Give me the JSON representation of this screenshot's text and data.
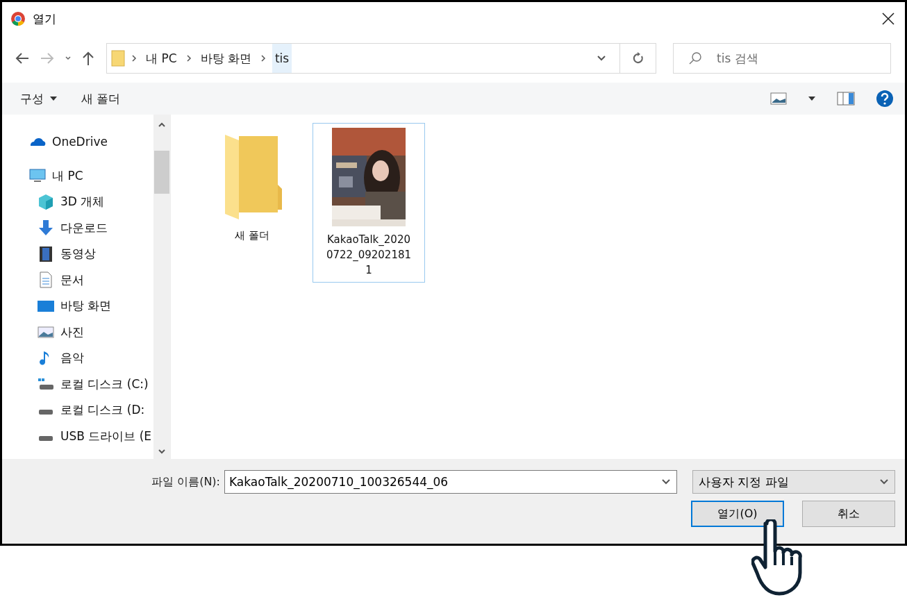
{
  "window": {
    "title": "열기"
  },
  "nav": {
    "breadcrumb": [
      {
        "label": "내 PC",
        "selected": false
      },
      {
        "label": "바탕 화면",
        "selected": false
      },
      {
        "label": "tis",
        "selected": true
      }
    ],
    "search": {
      "placeholder": "tis 검색"
    }
  },
  "toolbar": {
    "organize": "구성",
    "new_folder": "새 폴더"
  },
  "sidebar": {
    "items": [
      {
        "label": "OneDrive",
        "kind": "cloud"
      },
      {
        "label": "내 PC",
        "kind": "pc",
        "children": [
          {
            "label": "3D 개체",
            "kind": "cube"
          },
          {
            "label": "다운로드",
            "kind": "download"
          },
          {
            "label": "동영상",
            "kind": "video"
          },
          {
            "label": "문서",
            "kind": "document"
          },
          {
            "label": "바탕 화면",
            "kind": "desktop"
          },
          {
            "label": "사진"
          },
          {
            "label": "음악",
            "kind": "music"
          },
          {
            "label": "로컬 디스크 (C:)",
            "kind": "sysdrive"
          },
          {
            "label": "로컬 디스크 (D:",
            "kind": "drive"
          },
          {
            "label": "USB 드라이브 (E",
            "kind": "drive"
          }
        ]
      }
    ]
  },
  "files": [
    {
      "kind": "folder",
      "name": "새 폴더",
      "selected": false
    },
    {
      "kind": "picture",
      "name": "KakaoTalk_20200722_092021811",
      "selected": true
    }
  ],
  "footer": {
    "filename_label": "파일 이름(N):",
    "filename": "KakaoTalk_20200710_100326544_06",
    "filetype": "사용자 지정 파일",
    "buttons": [
      {
        "label": "열기(O)",
        "kind": "primary"
      },
      {
        "label": "취소",
        "kind": "normal"
      }
    ]
  }
}
